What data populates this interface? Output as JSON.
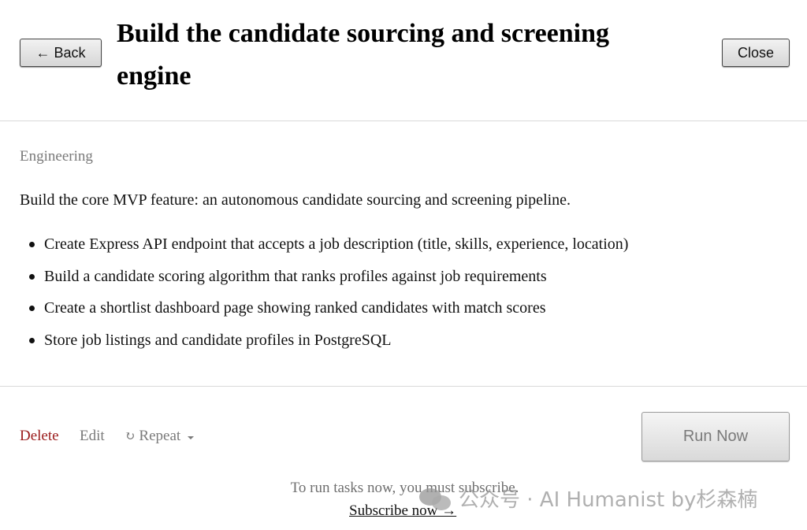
{
  "header": {
    "back_label": "← Back",
    "title": "Build the candidate sourcing and screening engine",
    "close_label": "Close"
  },
  "task": {
    "category": "Engineering",
    "description": "Build the core MVP feature: an autonomous candidate sourcing and screening pipeline.",
    "items": [
      "Create Express API endpoint that accepts a job description (title, skills, experience, location)",
      "Build a candidate scoring algorithm that ranks profiles against job requirements",
      "Create a shortlist dashboard page showing ranked candidates with match scores",
      "Store job listings and candidate profiles in PostgreSQL"
    ]
  },
  "footer": {
    "delete_label": "Delete",
    "edit_label": "Edit",
    "repeat_label": "Repeat",
    "repeat_icon": "↻",
    "run_now_label": "Run Now",
    "subscribe_note": "To run tasks now, you must subscribe.",
    "subscribe_link": "Subscribe now →"
  },
  "watermark": {
    "text": "公众号 · AI Humanist by杉森楠"
  },
  "colors": {
    "delete": "#9b1b1b",
    "muted": "#7a7a7a",
    "divider": "#d9d9d9"
  }
}
